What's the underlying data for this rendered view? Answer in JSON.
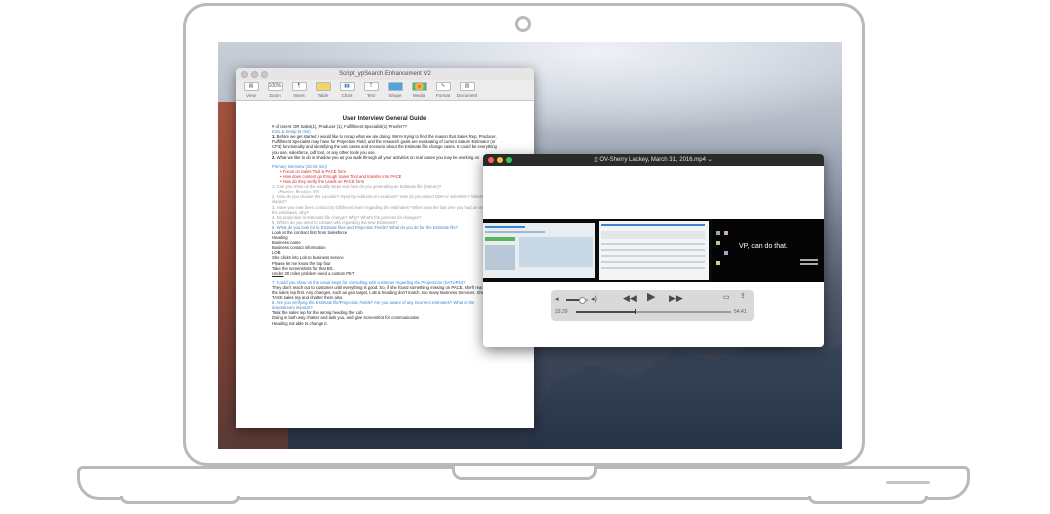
{
  "pages_window": {
    "title": "Script_ypSearch Enhancement V2",
    "toolbar": [
      {
        "label": "View",
        "icon": "view-icon"
      },
      {
        "label": "Zoom",
        "value": "100%"
      },
      {
        "label": "Insert",
        "icon": "paragraph-icon"
      },
      {
        "label": "Table",
        "icon": "table-icon"
      },
      {
        "label": "Chart",
        "icon": "chart-icon"
      },
      {
        "label": "Text",
        "icon": "text-icon"
      },
      {
        "label": "Shape",
        "icon": "shape-icon"
      },
      {
        "label": "Media",
        "icon": "media-icon"
      },
      {
        "label": "Format",
        "icon": "format-brush-icon"
      },
      {
        "label": "Document",
        "icon": "document-icon"
      }
    ],
    "doc": {
      "heading": "User Interview General Guide",
      "users": "# of Users: DR Sales(1), Producer (1), Fulfillment Specialist(1) Proofer??",
      "intro": "Intro & Setup (5 min)",
      "p1": "Before we get started I would like to recap what we are doing. We're trying to find the reason that Sales Rep, Producer, Fulfillment Specialist may have for Projection Field, and the research goals are evaluating of current Saturn Estimator (or CP3) functionality and identifying the use cases and scenario about the Estimate file change cases. It could be everything you use, salesforce, pdf tool, or any other tools you use.",
      "p2": "What we like to do is shadow you as you walk through all your activities on real cases you may be working on",
      "primary": "Primary Interview (15-25 min)",
      "bullets": [
        "Focus on Sales Tool & PACE form",
        "How does content go through Sales Tool and transfer into PACE",
        "How do they verify the Leads on PACE form"
      ],
      "q1": "Can you show us the usually steps and how do you generating an Estimate file (Saturn)?",
      "q1b": "(Plumber, Brooklyn, NY)",
      "q2": "How do you choose the Location? Input by Address or Locations? How do you select DMA or sub-DMA? What's the impact?",
      "q3": "Have you ever been contact by fulfillment team regarding the estimates? When was the last time you had an issue with the estimates, why?",
      "q4": "Do projection or Estimate file change? Why? What's the process for changes?",
      "q5": "Whom do you need to contact with regarding the new Estimates?",
      "q6": "What do you look for in Estimate files and Projection Fields? What do you do for the Estimate file?",
      "notes1": [
        "Look at the contract first from Salesforce",
        "Heading",
        "Business name",
        "Business contact information",
        "LOB",
        "She clicks into Lob to business service",
        "Please let me know the top four",
        "Take the screenshots for that BS."
      ],
      "notes1_last_ul": "Under",
      "notes1_last_rest": " 20 miles problem need a custom PET",
      "q7": "Could you show us the usual steps for consulting with customer regarding the Projections (SATURN)?",
      "notes2": "They don't reach out to customer until everything is good. So, if she found something missing on PACE, she'll reach out the sales rep first. Any changes, such as geo target, LoB & heading don't match, too many Business Services. She'll both TASK sales rep and chatter them also.",
      "q8": "Are you verifying the Estimate file/Projection Fields? Are you aware of any incorrect estimates? What is the downstream impacts?",
      "notes3": [
        "Task the sales rep for the wrong heading the Lob",
        "Doing in both way chatter and task you, and give screenshot for communication",
        "Heading not able to change it."
      ]
    }
  },
  "video_window": {
    "title": "OV-Sherry Lackey, March 31, 2016.mp4",
    "overlay_text": "VP, can do that.",
    "elapsed": "33:29",
    "remaining": "54:41",
    "progress": 0.38,
    "volume": 0.7
  },
  "colors": {
    "link_blue": "#3a86d0",
    "bullet_red": "#d32a2a",
    "close": "#fc605c",
    "minimize": "#fdbc40",
    "zoom": "#34c84a"
  }
}
